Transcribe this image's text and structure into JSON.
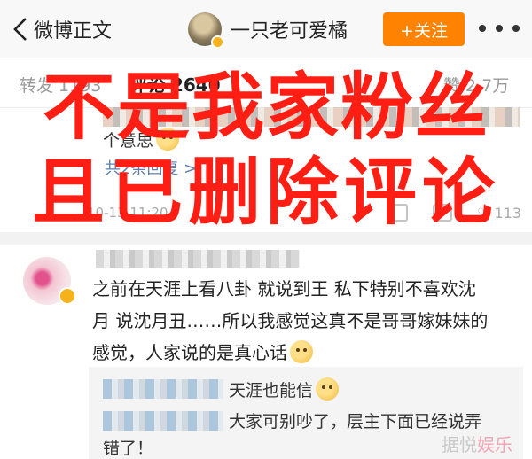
{
  "nav": {
    "back_label": "微博正文",
    "author_name": "一只老可爱橘",
    "follow_label": "+关注"
  },
  "tabs": {
    "repost": "转发 1193",
    "comment": "评论 2640",
    "like": "赞 2.7万"
  },
  "comment1": {
    "text": "个意思",
    "replies_link": "共2条回复 >",
    "time": "10-13 11:20",
    "like_count": "113"
  },
  "comment2": {
    "text_line1": "之前在天涯上看八卦 就说到王 私下特别不喜欢沈",
    "text_line2": "月 说沈月丑……所以我感觉这真不是哥哥嫁妹妹的",
    "text_line3": "感觉，人家说的是真心话"
  },
  "nested_replies": [
    {
      "text": "天涯也能信"
    },
    {
      "text_line1": "大家可别吵了，层主下面已经说弄",
      "text_line2": "错了！"
    }
  ],
  "overlay": {
    "line1": "不是我家粉丝",
    "line2": "且已删除评论"
  },
  "watermark": {
    "part1": "据悦",
    "part2": "娱乐"
  },
  "colors": {
    "follow_bg": "#ff8200",
    "overlay_red": "#ff1e14",
    "link_blue": "#5b7fb0",
    "verified_badge": "#f6b21a"
  },
  "icons": [
    "chevron-left-icon",
    "more-dots-icon",
    "verified-badge-icon",
    "repost-icon",
    "comment-icon",
    "like-icon",
    "emoji-icon"
  ]
}
